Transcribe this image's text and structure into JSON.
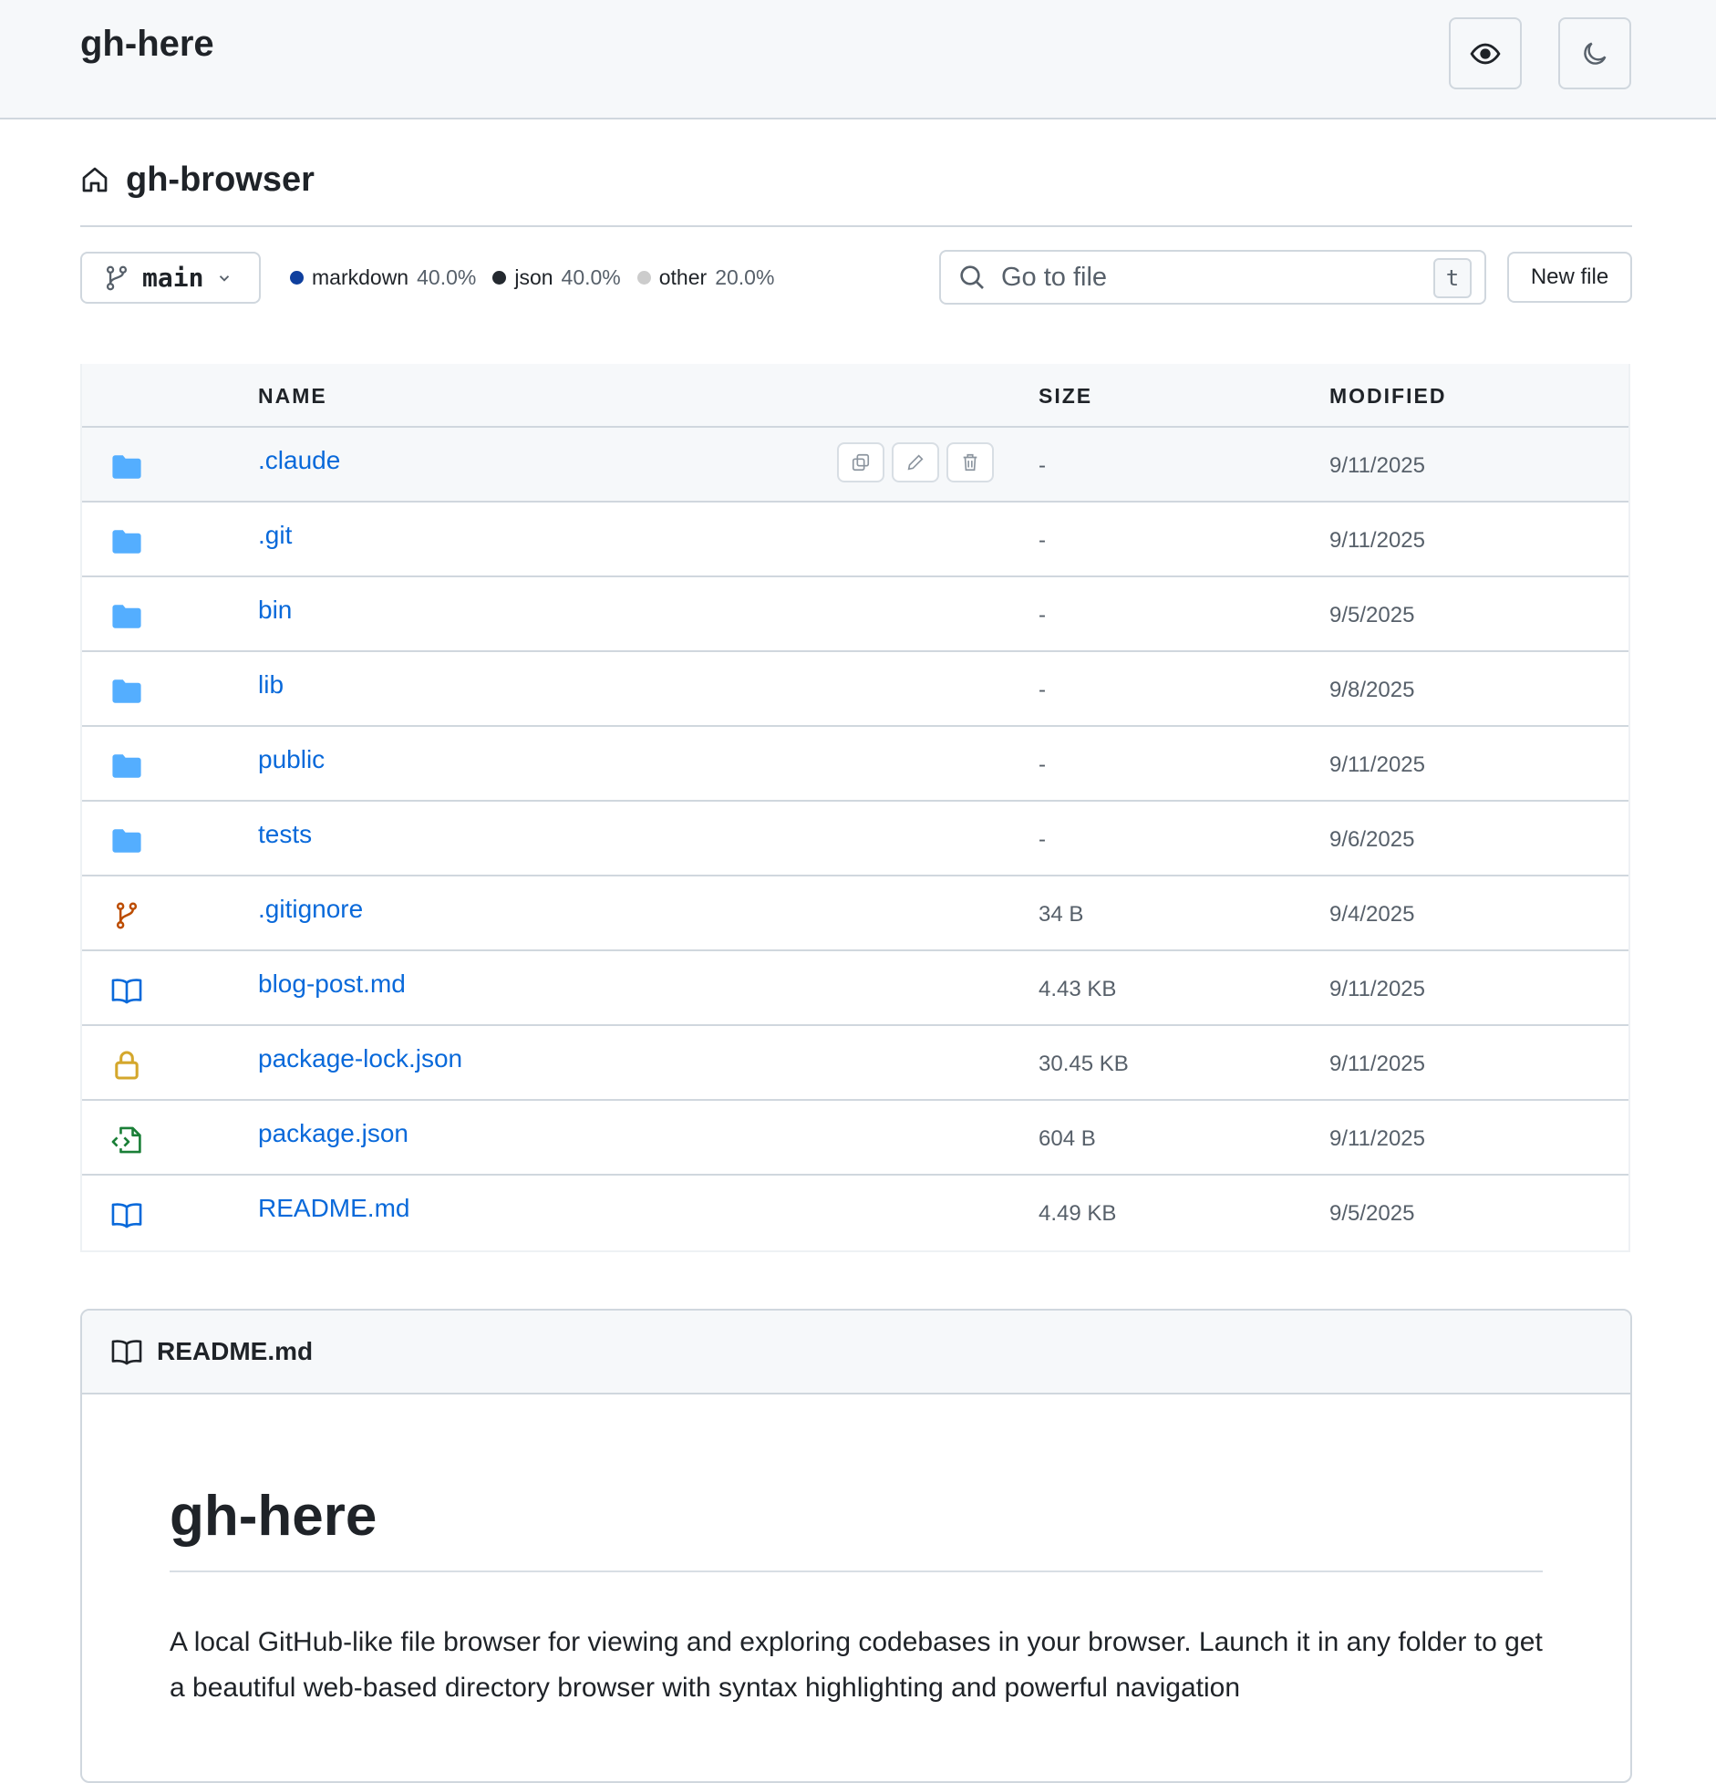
{
  "header": {
    "app_title": "gh-here",
    "buttons": [
      {
        "name": "eye-icon",
        "label": "Toggle preview"
      },
      {
        "name": "moon-icon",
        "label": "Toggle theme"
      }
    ]
  },
  "repo": {
    "name": "gh-browser",
    "branch": "main"
  },
  "languages": [
    {
      "name": "markdown",
      "percent": "40.0%",
      "color": "#0f3f9e"
    },
    {
      "name": "json",
      "percent": "40.0%",
      "color": "#24292f"
    },
    {
      "name": "other",
      "percent": "20.0%",
      "color": "#cccccc"
    }
  ],
  "search": {
    "placeholder": "Go to file",
    "shortcut": "t"
  },
  "new_file_label": "New file",
  "table": {
    "columns": {
      "name": "NAME",
      "size": "SIZE",
      "modified": "MODIFIED"
    },
    "rows": [
      {
        "name": ".claude",
        "type": "folder",
        "size": "-",
        "modified": "9/11/2025",
        "hover": true
      },
      {
        "name": ".git",
        "type": "folder",
        "size": "-",
        "modified": "9/11/2025"
      },
      {
        "name": "bin",
        "type": "folder",
        "size": "-",
        "modified": "9/5/2025"
      },
      {
        "name": "lib",
        "type": "folder",
        "size": "-",
        "modified": "9/8/2025"
      },
      {
        "name": "public",
        "type": "folder",
        "size": "-",
        "modified": "9/11/2025"
      },
      {
        "name": "tests",
        "type": "folder",
        "size": "-",
        "modified": "9/6/2025"
      },
      {
        "name": ".gitignore",
        "type": "git-branch",
        "size": "34 B",
        "modified": "9/4/2025"
      },
      {
        "name": "blog-post.md",
        "type": "book",
        "size": "4.43 KB",
        "modified": "9/11/2025"
      },
      {
        "name": "package-lock.json",
        "type": "lock",
        "size": "30.45 KB",
        "modified": "9/11/2025"
      },
      {
        "name": "package.json",
        "type": "file-code",
        "size": "604 B",
        "modified": "9/11/2025"
      },
      {
        "name": "README.md",
        "type": "book",
        "size": "4.49 KB",
        "modified": "9/5/2025"
      }
    ]
  },
  "readme": {
    "filename": "README.md",
    "heading": "gh-here",
    "paragraph": "A local GitHub-like file browser for viewing and exploring codebases in your browser. Launch it in any folder to get a beautiful web-based directory browser with syntax highlighting and powerful navigation"
  },
  "colors": {
    "link": "#0969da",
    "folder": "#54aeff",
    "git": "#bc4c00",
    "book": "#0969da",
    "lock": "#d4a72c",
    "code": "#1a7f37"
  }
}
